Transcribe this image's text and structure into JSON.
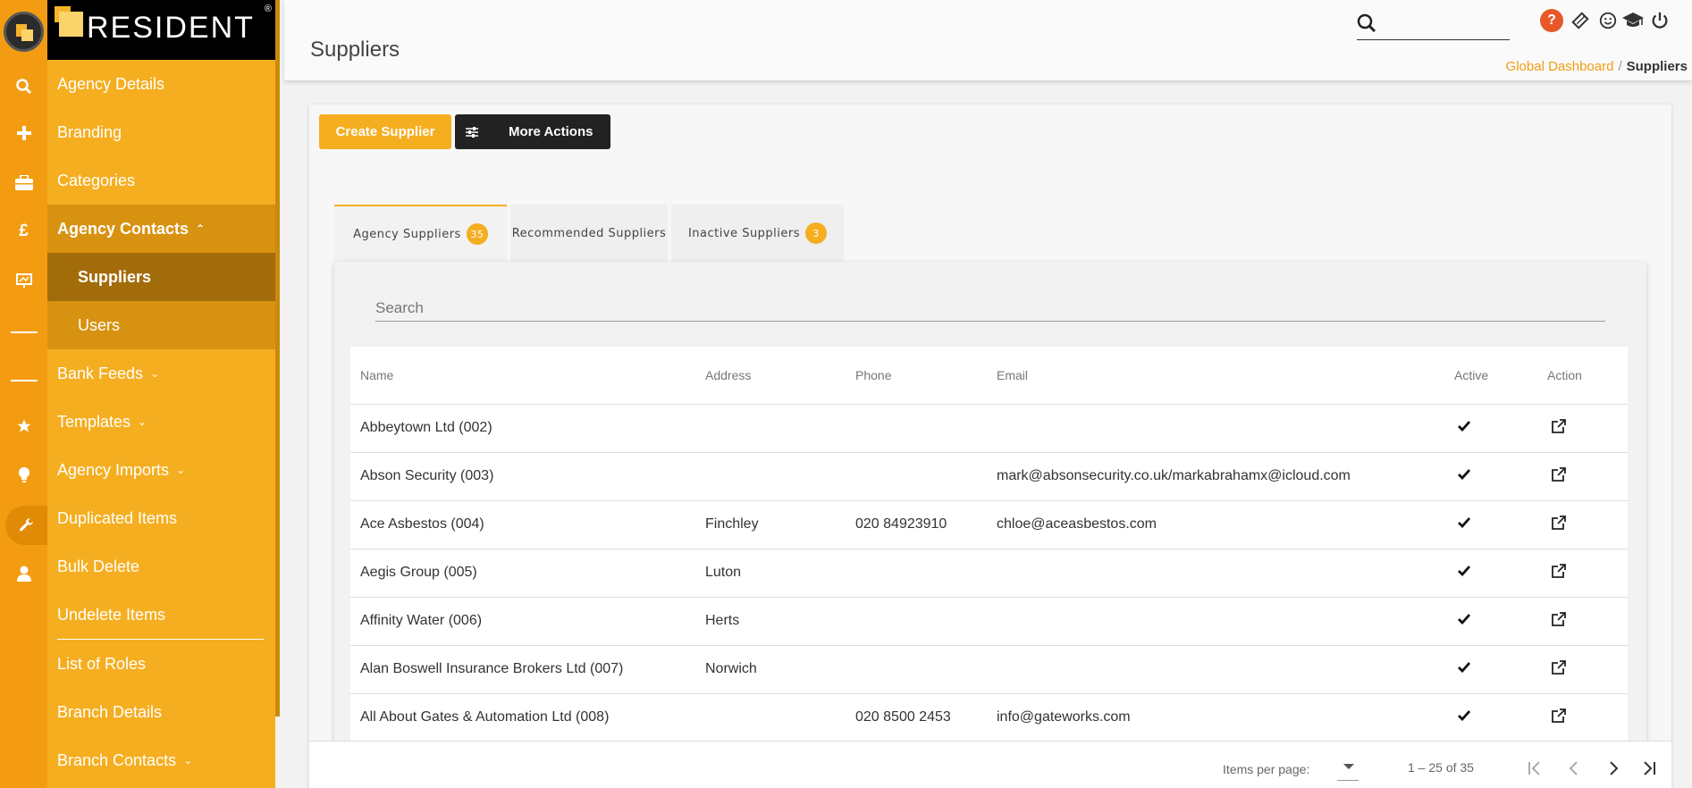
{
  "app": {
    "brand": "RESIDENT",
    "reg_mark": "®"
  },
  "rail": {
    "icons": [
      "search-icon",
      "plus-icon",
      "briefcase-icon",
      "pound-icon",
      "presentation-icon",
      "divider",
      "divider",
      "star-icon",
      "lightbulb-icon",
      "wrench-icon",
      "user-icon"
    ],
    "active_icon": "wrench-icon"
  },
  "sidebar": {
    "items": [
      {
        "label": "Agency Details"
      },
      {
        "label": "Branding"
      },
      {
        "label": "Categories"
      },
      {
        "label": "Agency Contacts",
        "chevron": "⌃"
      },
      {
        "label": "Suppliers"
      },
      {
        "label": "Users"
      },
      {
        "label": "Bank Feeds",
        "chevron": "⌄"
      },
      {
        "label": "Templates",
        "chevron": "⌄"
      },
      {
        "label": "Agency Imports",
        "chevron": "⌄"
      },
      {
        "label": "Duplicated Items"
      },
      {
        "label": "Bulk Delete"
      },
      {
        "label": "Undelete Items"
      },
      {
        "label": "List of Roles"
      },
      {
        "label": "Branch Details"
      },
      {
        "label": "Branch Contacts",
        "chevron": "⌄"
      }
    ]
  },
  "header": {
    "title": "Suppliers",
    "search_value": "",
    "icons": [
      "help-icon",
      "ticket-icon",
      "smiley-icon",
      "graduation-cap-icon",
      "power-icon"
    ],
    "help_glyph": "?",
    "breadcrumb": {
      "link": "Global Dashboard",
      "separator": "/",
      "current": "Suppliers"
    }
  },
  "toolbar": {
    "create_label": "Create Supplier",
    "more_label": "More Actions"
  },
  "tabs": [
    {
      "label": "Agency Suppliers",
      "badge": "35"
    },
    {
      "label": "Recommended Suppliers",
      "badge": ""
    },
    {
      "label": "Inactive Suppliers",
      "badge": "3"
    }
  ],
  "table": {
    "search_placeholder": "Search",
    "columns": [
      "Name",
      "Address",
      "Phone",
      "Email",
      "Active",
      "Action"
    ],
    "rows": [
      {
        "name": "Abbeytown Ltd (002)",
        "address": "",
        "phone": "",
        "email": "",
        "active": true
      },
      {
        "name": "Abson Security (003)",
        "address": "",
        "phone": "",
        "email": "mark@absonsecurity.co.uk/markabrahamx@icloud.com",
        "active": true
      },
      {
        "name": "Ace Asbestos (004)",
        "address": "Finchley",
        "phone": "020 84923910",
        "email": "chloe@aceasbestos.com",
        "active": true
      },
      {
        "name": "Aegis Group (005)",
        "address": "Luton",
        "phone": "",
        "email": "",
        "active": true
      },
      {
        "name": "Affinity Water (006)",
        "address": "Herts",
        "phone": "",
        "email": "",
        "active": true
      },
      {
        "name": "Alan Boswell Insurance Brokers Ltd (007)",
        "address": "Norwich",
        "phone": "",
        "email": "",
        "active": true
      },
      {
        "name": "All About Gates & Automation Ltd (008)",
        "address": "",
        "phone": "020 8500 2453",
        "email": "info@gateworks.com",
        "active": true
      }
    ]
  },
  "paginator": {
    "items_per_page_label": "Items per page:",
    "items_per_page_value": "",
    "range_label": "1 – 25 of 35"
  },
  "colors": {
    "accent": "#f5ae20",
    "rail": "#f39c12",
    "dark": "#222222",
    "help": "#e8572a"
  }
}
